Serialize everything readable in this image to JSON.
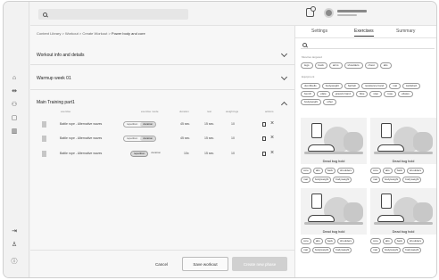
{
  "rail": {
    "icons": [
      "home-icon",
      "workout-icon",
      "users-icon",
      "chat-icon",
      "analytics-icon",
      "logout-icon",
      "accessibility-icon",
      "help-icon"
    ]
  },
  "topbar": {
    "search_placeholder": ""
  },
  "breadcrumb": {
    "items": [
      "Content Library",
      "Workout",
      "Create Workout",
      "Power body and core"
    ],
    "sep": ">"
  },
  "sections": {
    "info": "Workout info and details",
    "warmup": "Warmup week 01",
    "main": "Main Training part1"
  },
  "table": {
    "headers": [
      "exercise",
      "exercise mode",
      "duration",
      "rest",
      "weight kgs",
      "actions"
    ],
    "rows": [
      {
        "name": "Battle rope - Alternative waves",
        "mode_a": "repetition",
        "mode_b": "duration",
        "active": "b",
        "value": "45 sec.",
        "rest": "15 sec.",
        "weight": "10"
      },
      {
        "name": "Battle rope - Alternative waves",
        "mode_a": "repetition",
        "mode_b": "duration",
        "active": "b",
        "value": "45 sec.",
        "rest": "15 sec.",
        "weight": "10"
      },
      {
        "name": "Battle rope - Alternative waves",
        "mode_a": "repetition",
        "mode_b": "duration",
        "active": "a",
        "value": "10x",
        "rest": "15 sec.",
        "weight": "10"
      }
    ]
  },
  "footer": {
    "cancel": "Cancel",
    "save": "Save workout",
    "create": "Create new phase"
  },
  "panel": {
    "tabs": [
      "Settings",
      "Exercises",
      "Summary"
    ],
    "active_tab": 1,
    "muscles_label": "Muscles targeted",
    "muscles": [
      "legs",
      "back",
      "arms",
      "shoulders",
      "chest",
      "abs"
    ],
    "equipment_label": "Equipment",
    "equipment": [
      "dumbbells",
      "bodyweight",
      "barbell",
      "resistance band",
      "mat",
      "kettlebell",
      "bench",
      "plate",
      "gravels band",
      "bike",
      "step",
      "rope",
      "pilates",
      "bodyweight",
      "other"
    ],
    "cards": [
      {
        "title": "Dead bug hold",
        "tags1": [
          "core",
          "abs",
          "back",
          "shoulders"
        ],
        "tags2": [
          "mat",
          "bodyweight",
          "bodyweight"
        ]
      },
      {
        "title": "Dead bug hold",
        "tags1": [
          "core",
          "abs",
          "back",
          "shoulders"
        ],
        "tags2": [
          "mat",
          "bodyweight",
          "bodyweight"
        ]
      },
      {
        "title": "Dead bug hold",
        "tags1": [
          "core",
          "abs",
          "back",
          "shoulders"
        ],
        "tags2": [
          "mat",
          "bodyweight",
          "bodyweight"
        ]
      },
      {
        "title": "Dead bug hold",
        "tags1": [
          "core",
          "abs",
          "back",
          "shoulders"
        ],
        "tags2": [
          "mat",
          "bodyweight",
          "bodyweight"
        ]
      }
    ]
  }
}
